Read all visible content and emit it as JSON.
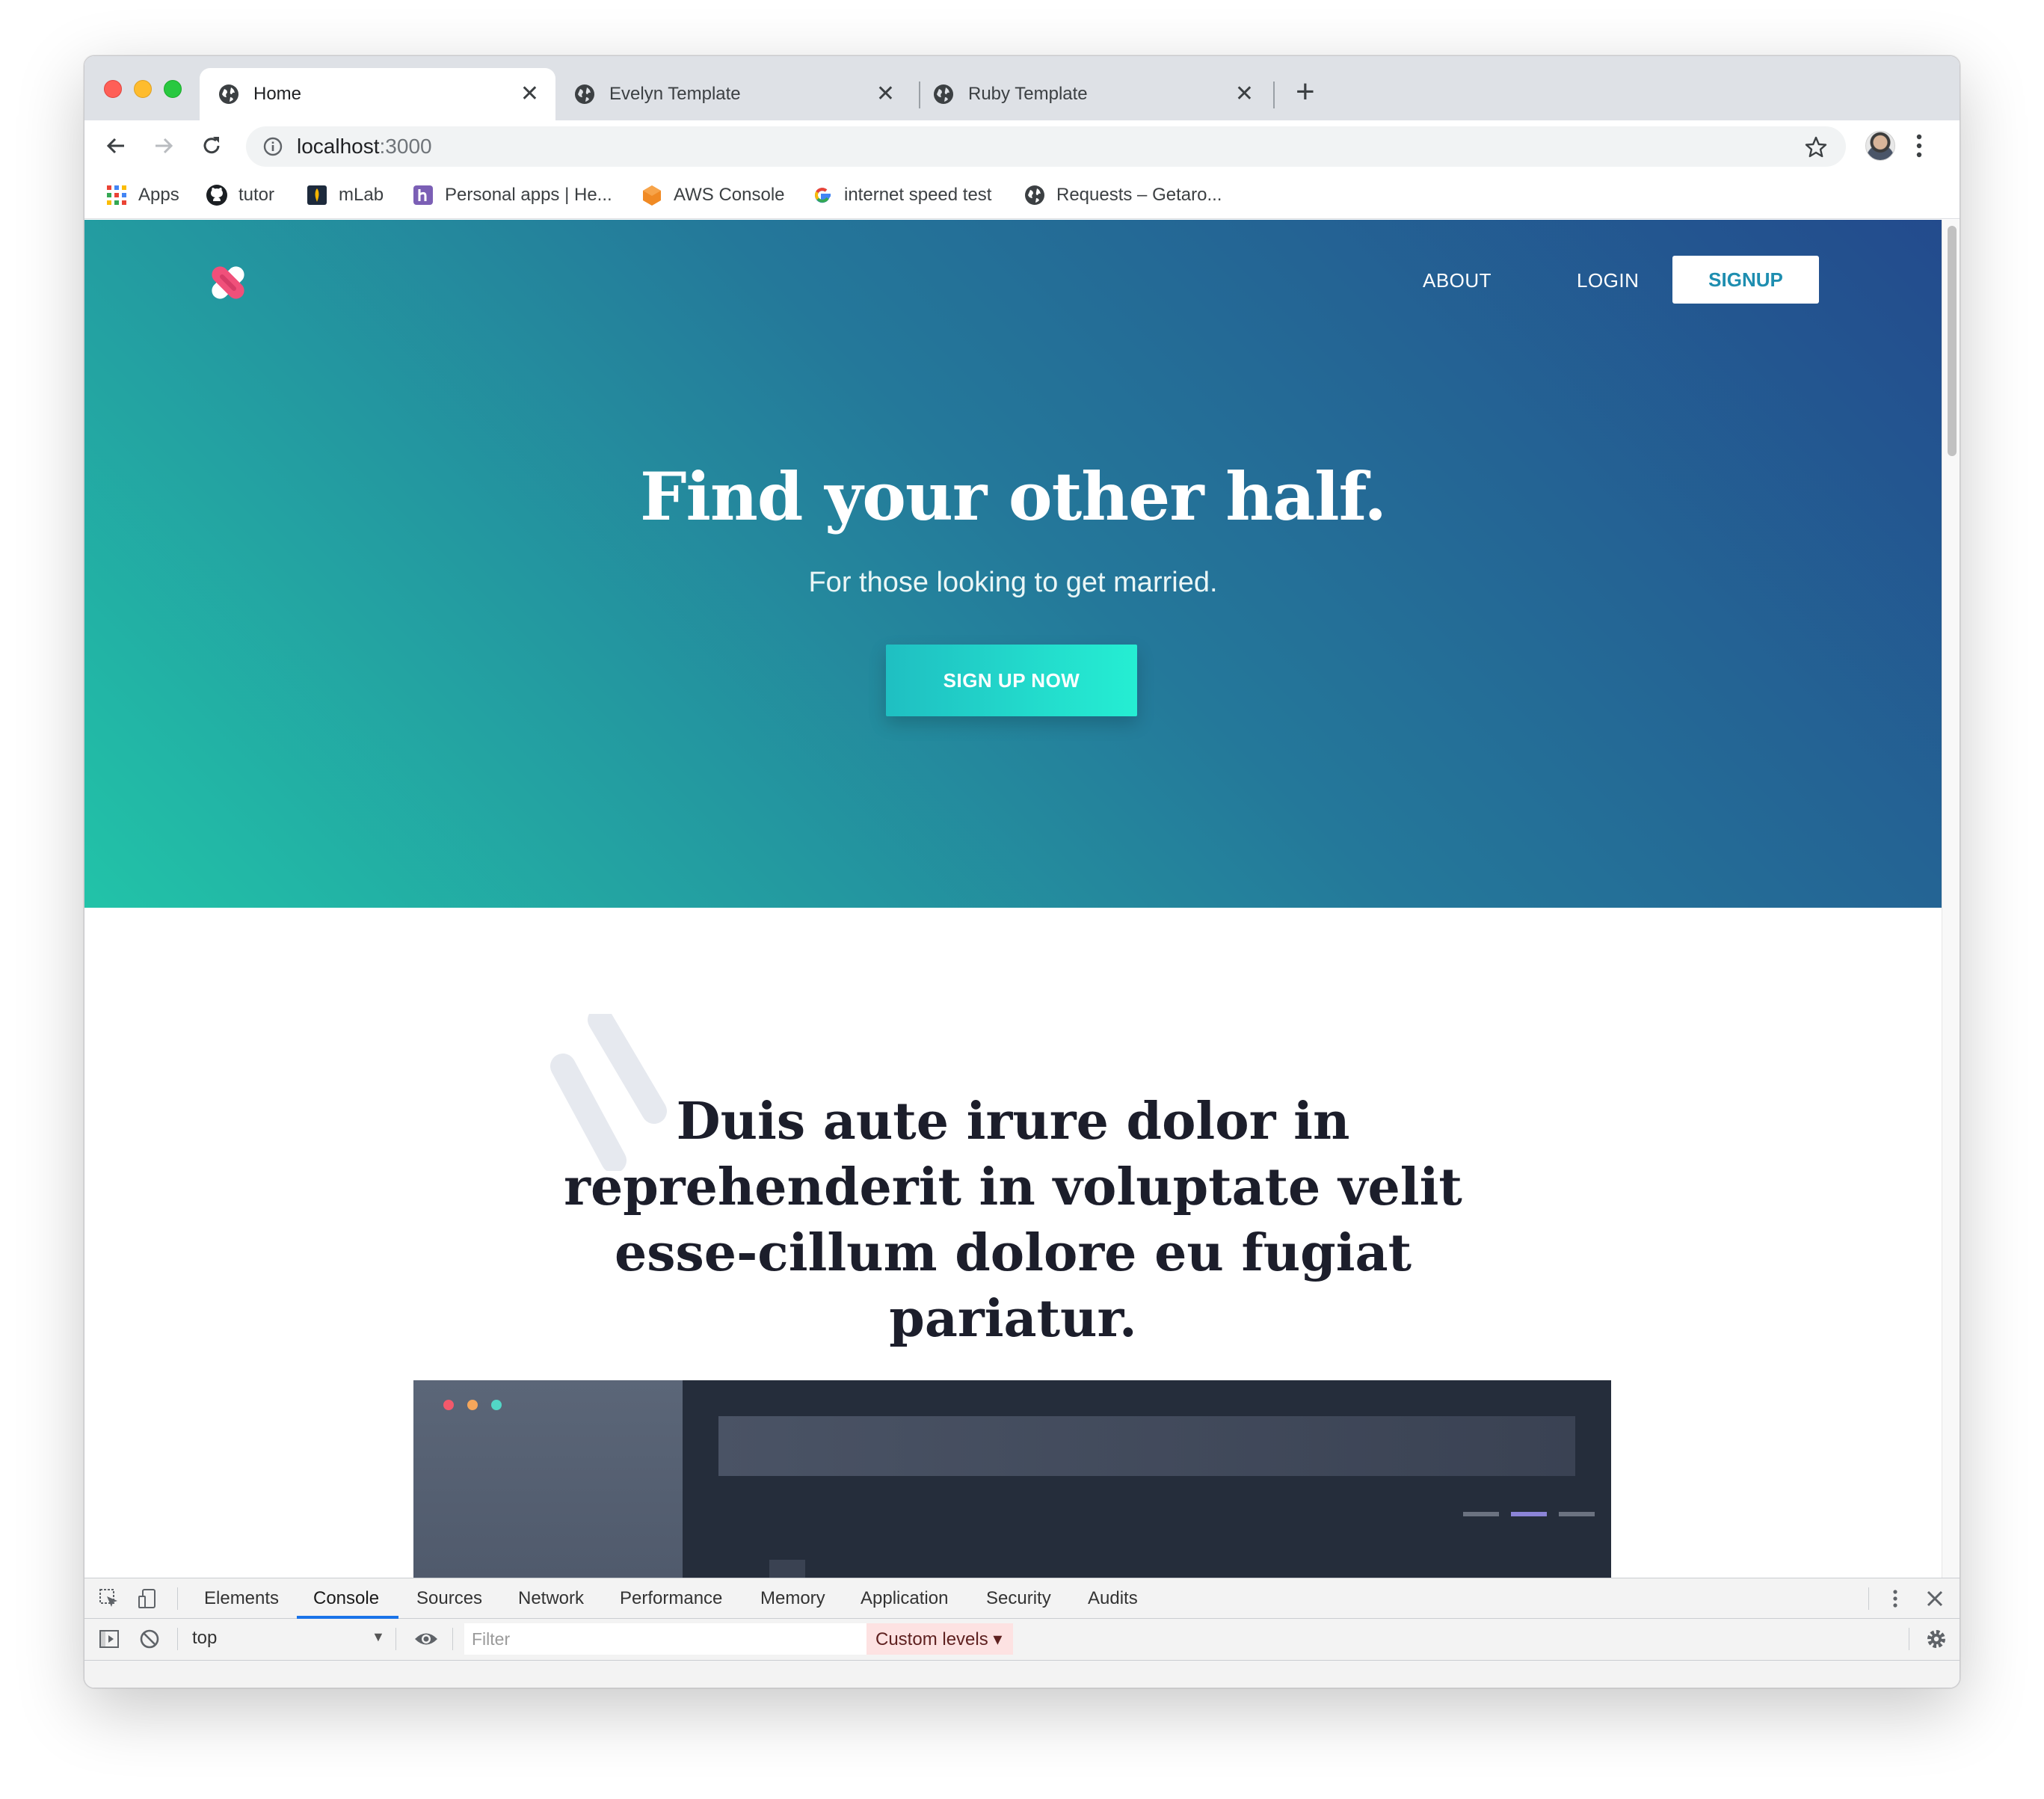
{
  "browser": {
    "tabs": [
      {
        "title": "Home",
        "close": "✕"
      },
      {
        "title": "Evelyn Template",
        "close": "✕"
      },
      {
        "title": "Ruby Template",
        "close": "✕"
      }
    ],
    "new_tab": "+",
    "url_host": "localhost",
    "url_port": ":3000"
  },
  "bookmarks": [
    {
      "label": "Apps",
      "icon": "apps-grid-icon"
    },
    {
      "label": "tutor",
      "icon": "github-icon"
    },
    {
      "label": "mLab",
      "icon": "mlab-icon"
    },
    {
      "label": "Personal apps | He...",
      "icon": "heroku-icon"
    },
    {
      "label": "AWS Console",
      "icon": "aws-icon"
    },
    {
      "label": "internet speed test",
      "icon": "google-icon"
    },
    {
      "label": "Requests – Getaro...",
      "icon": "globe-icon"
    }
  ],
  "site": {
    "nav": {
      "about": "ABOUT",
      "login": "LOGIN",
      "signup": "SIGNUP"
    },
    "hero": {
      "title": "Find your other half.",
      "subtitle": "For those looking to get married.",
      "cta": "SIGN UP NOW"
    },
    "section_title": "Duis aute irure dolor in reprehenderit in voluptate velit esse-cillum dolore eu fugiat pariatur."
  },
  "devtools": {
    "tabs": [
      "Elements",
      "Console",
      "Sources",
      "Network",
      "Performance",
      "Memory",
      "Application",
      "Security",
      "Audits"
    ],
    "active_tab": "Console",
    "context": "top",
    "filter_placeholder": "Filter",
    "levels": "Custom levels ▾"
  },
  "colors": {
    "hero_gradient_start": "#22c3a8",
    "hero_gradient_end": "#234b8d",
    "cta_start": "#1fbfc2",
    "cta_end": "#25eed3",
    "signup_text": "#1e8eb0",
    "mock_accent": "#8b84d7"
  }
}
